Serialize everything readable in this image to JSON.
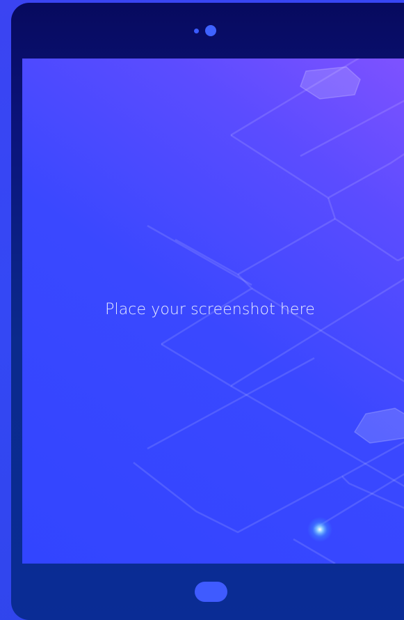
{
  "device": {
    "type": "tablet",
    "camera_icons": [
      "camera-dot-small",
      "camera-dot-large"
    ],
    "home_button_icon": "home-button"
  },
  "screen": {
    "placeholder_text": "Place your screenshot here"
  },
  "colors": {
    "background": "#3a42ee",
    "bezel_top": "#070a5e",
    "bezel_bottom": "#0a2c95",
    "screen_gradient_start": "#7e52ff",
    "screen_gradient_end": "#3245ff",
    "accent": "#3f5bff",
    "text": "#e8ecff"
  }
}
